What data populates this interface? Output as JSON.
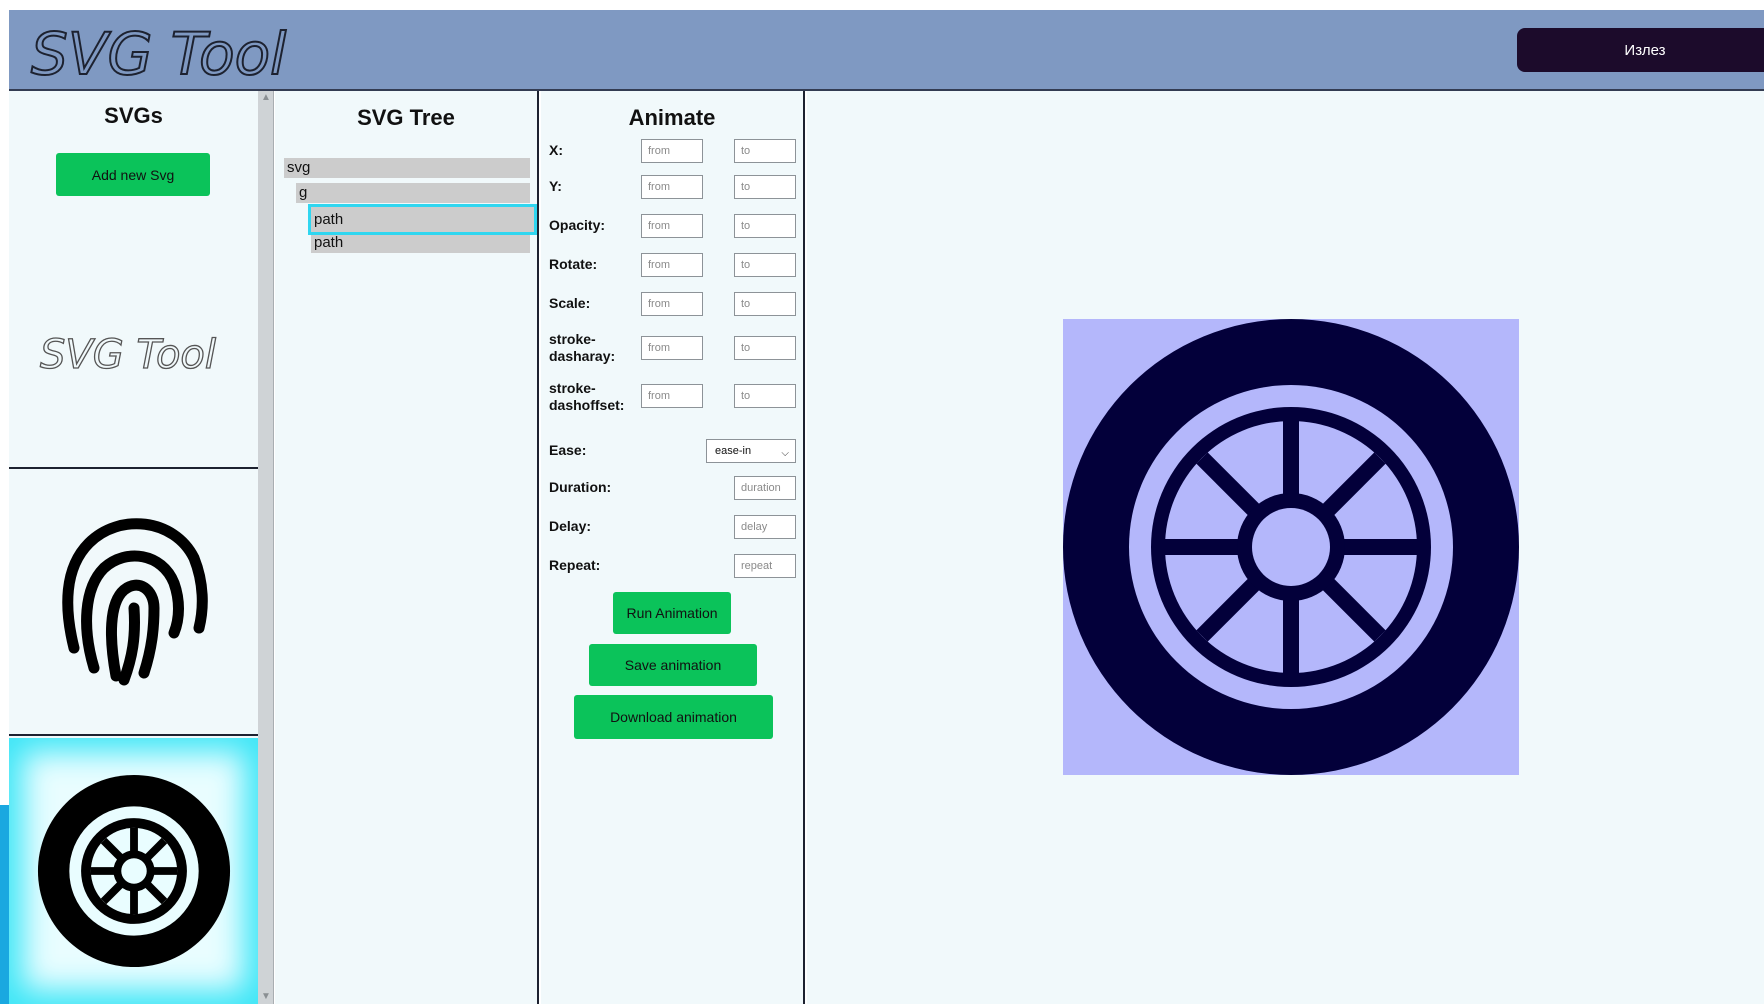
{
  "header": {
    "logo_text": "SVG Tool",
    "logout_label": "Излез",
    "bg_color": "#7f99c2"
  },
  "svgs_panel": {
    "title": "SVGs",
    "add_button_label": "Add new Svg",
    "items": [
      {
        "name": "svg-tool-logo",
        "text": "SVG Tool",
        "selected": false
      },
      {
        "name": "fingerprint",
        "selected": false
      },
      {
        "name": "wheel",
        "selected": true
      }
    ]
  },
  "tree_panel": {
    "title": "SVG Tree",
    "nodes": [
      {
        "label": "svg",
        "depth": 0
      },
      {
        "label": "g",
        "depth": 1
      },
      {
        "label": "path",
        "depth": 2,
        "selected": true
      },
      {
        "label": "path",
        "depth": 2
      }
    ]
  },
  "animate_panel": {
    "title": "Animate",
    "rows": [
      {
        "label": "X:",
        "from_placeholder": "from",
        "to_placeholder": "to"
      },
      {
        "label": "Y:",
        "from_placeholder": "from",
        "to_placeholder": "to"
      },
      {
        "label": "Opacity:",
        "from_placeholder": "from",
        "to_placeholder": "to"
      },
      {
        "label": "Rotate:",
        "from_placeholder": "from",
        "to_placeholder": "to"
      },
      {
        "label": "Scale:",
        "from_placeholder": "from",
        "to_placeholder": "to"
      },
      {
        "label_line1": "stroke-",
        "label_line2": "dasharay:",
        "from_placeholder": "from",
        "to_placeholder": "to"
      },
      {
        "label_line1": "stroke-",
        "label_line2": "dashoffset:",
        "from_placeholder": "from",
        "to_placeholder": "to"
      }
    ],
    "ease": {
      "label": "Ease:",
      "selected": "ease-in"
    },
    "duration": {
      "label": "Duration:",
      "placeholder": "duration"
    },
    "delay": {
      "label": "Delay:",
      "placeholder": "delay"
    },
    "repeat": {
      "label": "Repeat:",
      "placeholder": "repeat"
    },
    "buttons": {
      "run": "Run Animation",
      "save": "Save animation",
      "download": "Download animation"
    },
    "button_color": "#0bc35a"
  },
  "preview": {
    "background_color": "#b4b7fb",
    "fill_color": "#03003a"
  }
}
